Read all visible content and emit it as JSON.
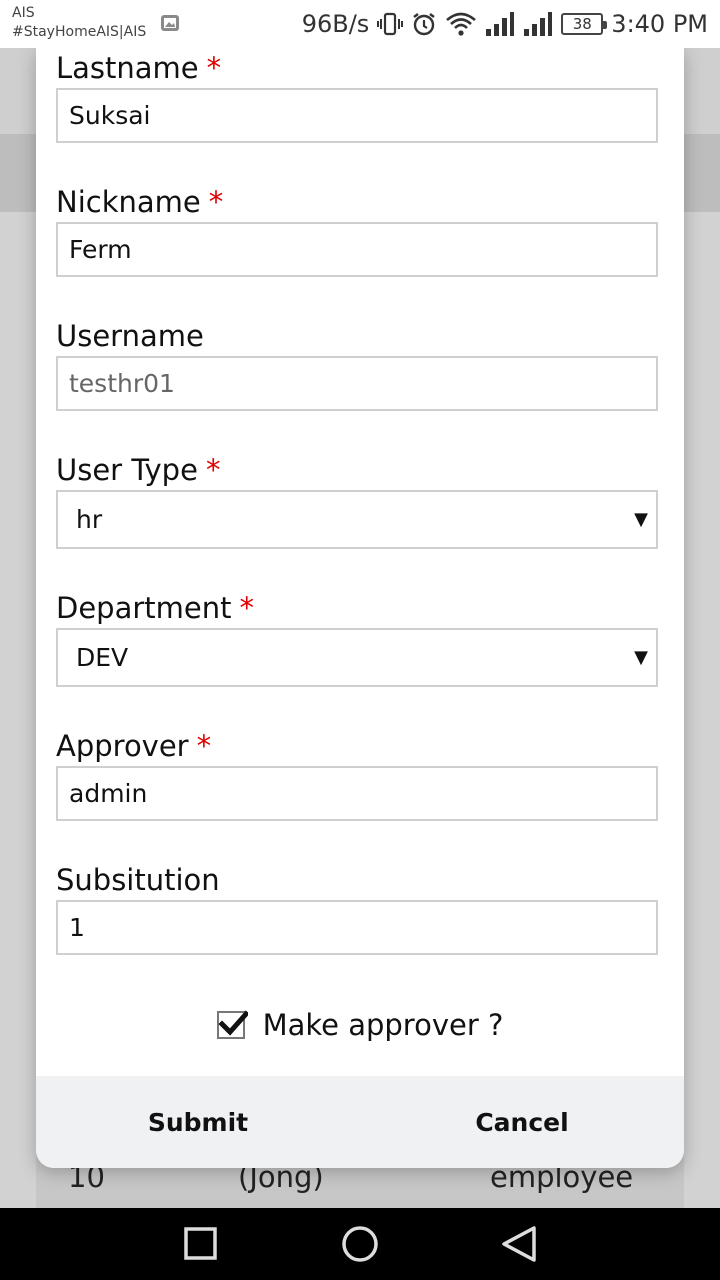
{
  "status_bar": {
    "carrier_line1": "AIS",
    "carrier_line2": "#StayHomeAIS|AIS",
    "net_speed": "96B/s",
    "battery_level": "38",
    "time": "3:40 PM",
    "icons": [
      "image-icon",
      "vibrate-icon",
      "alarm-icon",
      "wifi-icon",
      "signal-icon",
      "signal-icon",
      "battery-icon"
    ]
  },
  "form": {
    "lastname": {
      "label": "Lastname",
      "value": "Suksai",
      "required": true
    },
    "nickname": {
      "label": "Nickname",
      "value": "Ferm",
      "required": true
    },
    "username": {
      "label": "Username",
      "value": "testhr01",
      "required": false
    },
    "user_type": {
      "label": "User Type",
      "value": "hr",
      "required": true
    },
    "department": {
      "label": "Department",
      "value": "DEV",
      "required": true
    },
    "approver": {
      "label": "Approver",
      "value": "admin",
      "required": true
    },
    "substitution": {
      "label": "Subsitution",
      "value": "1",
      "required": false
    },
    "required_mark": "*",
    "make_approver": {
      "label": "Make approver ?",
      "checked": true
    }
  },
  "actions": {
    "submit": "Submit",
    "cancel": "Cancel"
  },
  "background_row": {
    "col1": "10",
    "col2": "(Jong)",
    "col3": "employee"
  },
  "colors": {
    "required": "#e00000",
    "footer_bg": "#f0f1f3",
    "input_border": "#cfcfcf"
  }
}
